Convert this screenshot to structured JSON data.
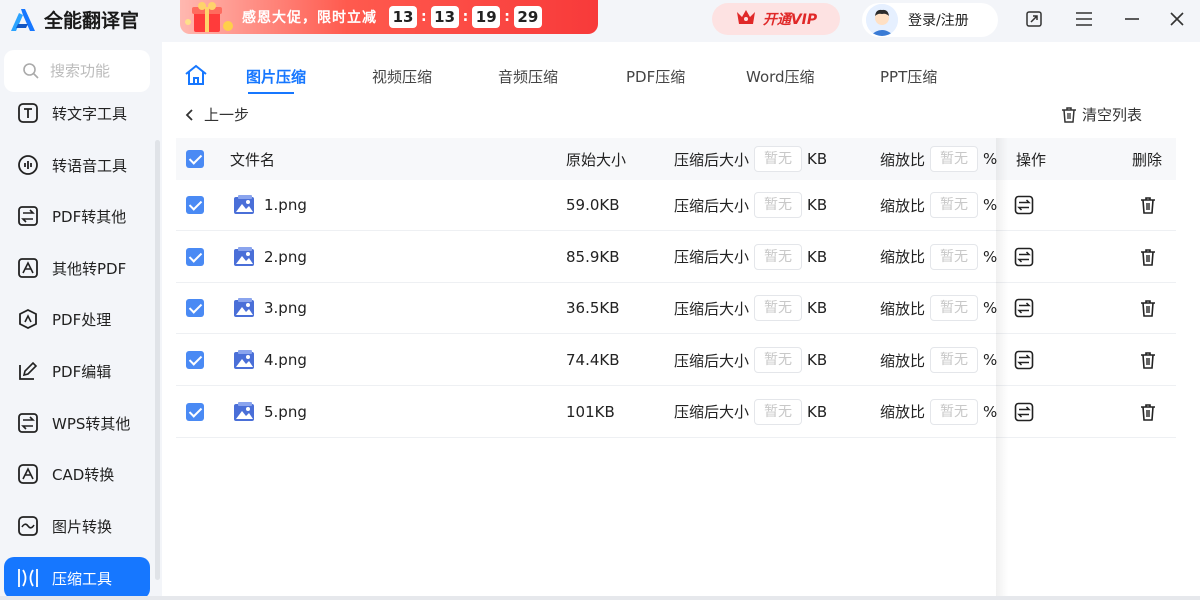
{
  "app": {
    "title": "全能翻译官"
  },
  "promo": {
    "text": "感恩大促，限时立减",
    "timer": [
      "13",
      "13",
      "19",
      "29"
    ]
  },
  "header": {
    "vip_label": "开通VIP",
    "login_label": "登录/注册"
  },
  "search": {
    "placeholder": "搜索功能"
  },
  "sidebar": {
    "items": [
      {
        "label": "转文字工具",
        "icon": "text-t-icon"
      },
      {
        "label": "转语音工具",
        "icon": "audio-wave-icon"
      },
      {
        "label": "PDF转其他",
        "icon": "swap-icon"
      },
      {
        "label": "其他转PDF",
        "icon": "pdf-arrow-icon"
      },
      {
        "label": "PDF处理",
        "icon": "pdf-process-icon"
      },
      {
        "label": "PDF编辑",
        "icon": "edit-icon"
      },
      {
        "label": "WPS转其他",
        "icon": "wps-swap-icon"
      },
      {
        "label": "CAD转换",
        "icon": "cad-icon"
      },
      {
        "label": "图片转换",
        "icon": "image-icon"
      },
      {
        "label": "压缩工具",
        "icon": "compress-icon",
        "active": true
      }
    ]
  },
  "tabs": [
    {
      "label": "图片压缩",
      "active": true
    },
    {
      "label": "视频压缩"
    },
    {
      "label": "音频压缩"
    },
    {
      "label": "PDF压缩"
    },
    {
      "label": "Word压缩"
    },
    {
      "label": "PPT压缩"
    }
  ],
  "toolbar": {
    "back_label": "上一步",
    "clear_label": "清空列表"
  },
  "table": {
    "headers": {
      "filename": "文件名",
      "orig_size": "原始大小",
      "compressed_size": "压缩后大小",
      "ratio": "缩放比",
      "ops": "操作",
      "delete": "删除"
    },
    "placeholder": "暂无",
    "unit_kb": "KB",
    "unit_pct": "%",
    "rows": [
      {
        "name": "1.png",
        "size": "59.0KB"
      },
      {
        "name": "2.png",
        "size": "85.9KB"
      },
      {
        "name": "3.png",
        "size": "36.5KB"
      },
      {
        "name": "4.png",
        "size": "74.4KB"
      },
      {
        "name": "5.png",
        "size": "101KB"
      }
    ]
  },
  "colors": {
    "accent": "#1677ff",
    "promo": "#f83a3a",
    "vip": "#e02828",
    "checkbox": "#4a8af4",
    "file_icon": "#4a6fd8"
  }
}
